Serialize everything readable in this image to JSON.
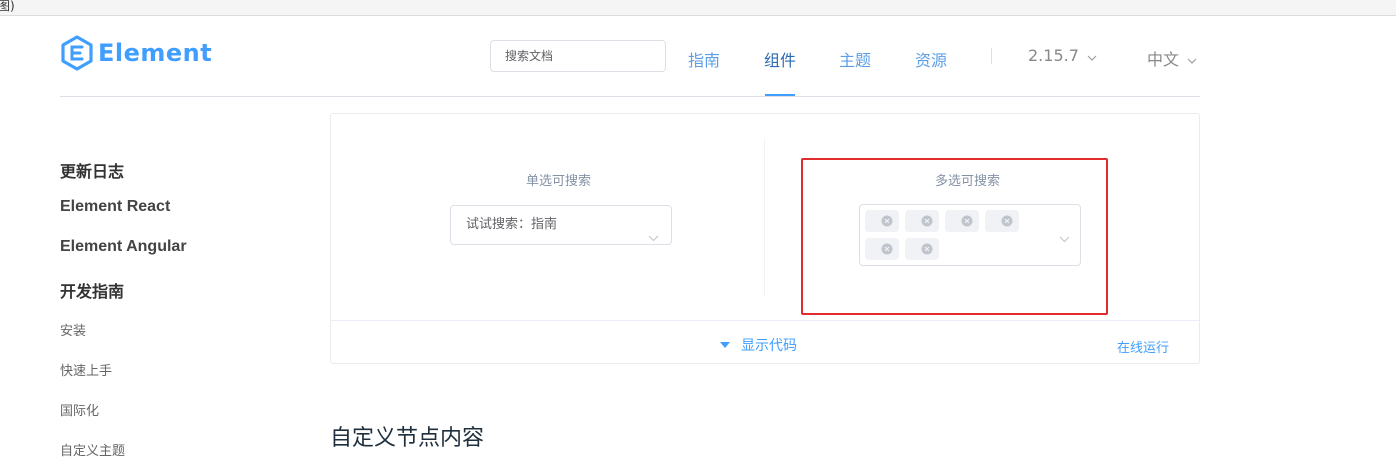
{
  "browser": {
    "fragment": "图)"
  },
  "header": {
    "logo_text": "Element",
    "search_placeholder": "搜索文档",
    "nav": [
      "指南",
      "组件",
      "主题",
      "资源"
    ],
    "active_nav": "组件",
    "version": "2.15.7",
    "language": "中文"
  },
  "sidebar": {
    "groups": [
      "更新日志",
      "Element React",
      "Element Angular",
      "开发指南"
    ],
    "items": [
      "安装",
      "快速上手",
      "国际化",
      "自定义主题"
    ]
  },
  "demo": {
    "single": {
      "title": "单选可搜索",
      "value": "试试搜索：指南"
    },
    "multi": {
      "title": "多选可搜索",
      "tag_count": 6
    },
    "show_code": "显示代码",
    "run_online": "在线运行"
  },
  "section": {
    "title": "自定义节点内容"
  },
  "colors": {
    "brand": "#409eff",
    "highlight": "#e02c2c",
    "tag_bg": "#f0f2f5",
    "border": "#dcdfe6"
  },
  "icons": {
    "logo": "element-hexagon-logo",
    "dropdown": "chevron-down-icon",
    "tag_close": "circle-close-icon",
    "show_code": "caret-down-icon"
  }
}
